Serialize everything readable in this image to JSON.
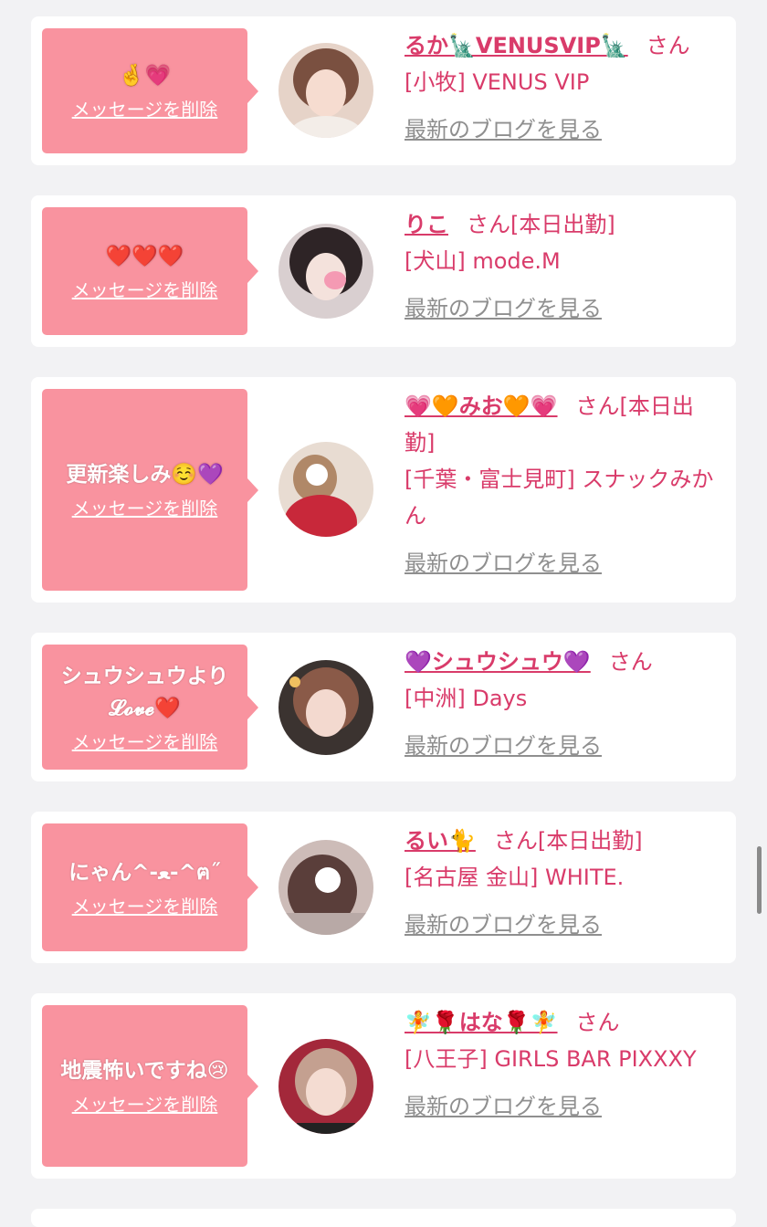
{
  "delete_label": "メッセージを削除",
  "blog_label": "最新のブログを見る",
  "san_label": "さん",
  "colors": {
    "background": "#f2f2f4",
    "bubble": "#f9939f",
    "accent": "#d93b6a",
    "link_gray": "#8f8f8f"
  },
  "cards": [
    {
      "message": "🤞💗",
      "name": "るか🗽VENUSVIP🗽",
      "status": "",
      "shop": "[小牧] VENUS VIP"
    },
    {
      "message": "❤️❤️❤️",
      "name": "りこ",
      "status": "[本日出勤]",
      "shop": "[犬山] mode.M"
    },
    {
      "message": "更新楽しみ☺️💜",
      "name": "💗🧡みお🧡💗",
      "status": "[本日出勤]",
      "shop": "[千葉・富士見町] スナックみかん"
    },
    {
      "message": "シュウシュウより𝓛𝓸𝓿𝓮❤️",
      "name": "💜シュウシュウ💜",
      "status": "",
      "shop": "[中洲] Days"
    },
    {
      "message": "にゃん^-ﻌ-^ฅ˝",
      "name": "るい🐈",
      "status": "[本日出勤]",
      "shop": "[名古屋 金山] WHITE."
    },
    {
      "message": "地震怖いですね😢",
      "name": "🧚🌹はな🌹🧚",
      "status": "",
      "shop": "[八王子] GIRLS BAR PIXXXY"
    }
  ]
}
